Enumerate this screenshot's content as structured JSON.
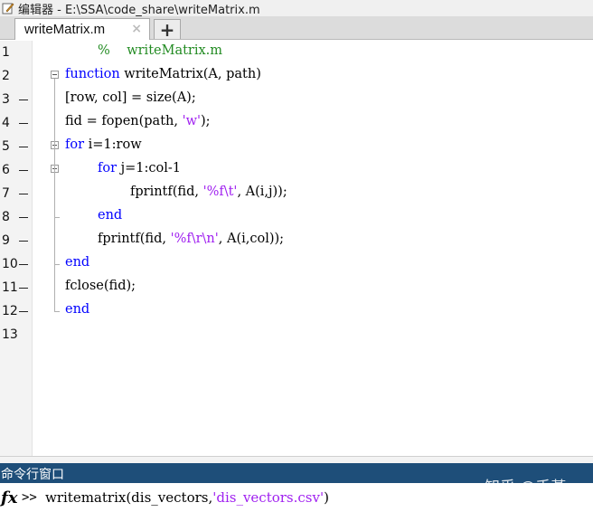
{
  "window": {
    "title": "编辑器 - E:\\SSA\\code_share\\writeMatrix.m",
    "icon": "pencil-icon"
  },
  "tabs": [
    {
      "label": "writeMatrix.m",
      "close_icon": "×"
    }
  ],
  "new_tab_label": "+",
  "editor": {
    "lines": [
      {
        "n": "1",
        "dash": false,
        "fold": false,
        "indent": 1,
        "parts": [
          {
            "t": "%    writeMatrix.m",
            "c": "cmt"
          }
        ]
      },
      {
        "n": "2",
        "dash": false,
        "fold": true,
        "indent": 0,
        "parts": [
          {
            "t": "function",
            "c": "kw"
          },
          {
            "t": " writeMatrix(A, path)",
            "c": ""
          }
        ]
      },
      {
        "n": "3",
        "dash": true,
        "fold": false,
        "indent": 0,
        "parts": [
          {
            "t": "[row, col] = size(A);",
            "c": ""
          }
        ]
      },
      {
        "n": "4",
        "dash": true,
        "fold": false,
        "indent": 0,
        "parts": [
          {
            "t": "fid = fopen(path, ",
            "c": ""
          },
          {
            "t": "'w'",
            "c": "str"
          },
          {
            "t": ");",
            "c": ""
          }
        ]
      },
      {
        "n": "5",
        "dash": true,
        "fold": true,
        "indent": 0,
        "parts": [
          {
            "t": "for",
            "c": "kw"
          },
          {
            "t": " i=1:row",
            "c": ""
          }
        ]
      },
      {
        "n": "6",
        "dash": true,
        "fold": true,
        "indent": 1,
        "parts": [
          {
            "t": "for",
            "c": "kw"
          },
          {
            "t": " j=1:col-1",
            "c": ""
          }
        ]
      },
      {
        "n": "7",
        "dash": true,
        "fold": false,
        "indent": 2,
        "parts": [
          {
            "t": "fprintf(fid, ",
            "c": ""
          },
          {
            "t": "'%f\\t'",
            "c": "str"
          },
          {
            "t": ", A(i,j));",
            "c": ""
          }
        ]
      },
      {
        "n": "8",
        "dash": true,
        "fold": false,
        "indent": 1,
        "parts": [
          {
            "t": "end",
            "c": "kw"
          }
        ]
      },
      {
        "n": "9",
        "dash": true,
        "fold": false,
        "indent": 1,
        "parts": [
          {
            "t": "fprintf(fid, ",
            "c": ""
          },
          {
            "t": "'%f\\r\\n'",
            "c": "str"
          },
          {
            "t": ", A(i,col));",
            "c": ""
          }
        ]
      },
      {
        "n": "10",
        "dash": true,
        "fold": false,
        "indent": 0,
        "parts": [
          {
            "t": "end",
            "c": "kw"
          }
        ]
      },
      {
        "n": "11",
        "dash": true,
        "fold": false,
        "indent": 0,
        "parts": [
          {
            "t": "fclose(fid);",
            "c": ""
          }
        ]
      },
      {
        "n": "12",
        "dash": true,
        "fold": false,
        "indent": 0,
        "parts": [
          {
            "t": "end",
            "c": "kw"
          }
        ]
      },
      {
        "n": "13",
        "dash": false,
        "fold": false,
        "indent": 0,
        "parts": []
      }
    ]
  },
  "command_window": {
    "title": "命令行窗口",
    "fx": "fx",
    "prompt": ">>",
    "command_parts": [
      {
        "t": "writematrix(dis_vectors,",
        "c": ""
      },
      {
        "t": "'dis_vectors.csv'",
        "c": "str"
      },
      {
        "t": ")",
        "c": ""
      }
    ]
  },
  "watermark": "知乎 @禾堇",
  "colors": {
    "keyword": "#0000ff",
    "string": "#a020f0",
    "comment": "#228b22",
    "command_bar": "#1e4e79"
  }
}
